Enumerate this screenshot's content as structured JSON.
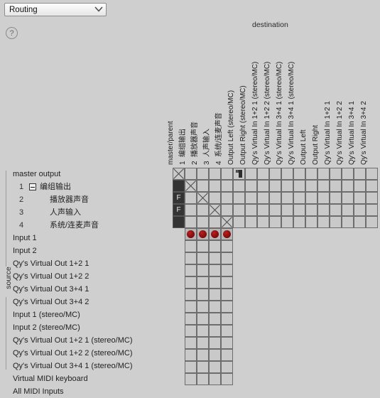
{
  "window": {
    "mode_select_value": "Routing",
    "help_icon": "question-mark-icon",
    "chevron_icon": "chevron-down-icon"
  },
  "axes": {
    "destination_label": "destination",
    "source_label": "source"
  },
  "columns": [
    {
      "num": "",
      "label": "master/parent"
    },
    {
      "num": "1",
      "label": "编组输出"
    },
    {
      "num": "2",
      "label": "播放器声音"
    },
    {
      "num": "3",
      "label": "人声输入"
    },
    {
      "num": "4",
      "label": "系统/连麦声音"
    },
    {
      "num": "",
      "label": "Output Left (stereo/MC)"
    },
    {
      "num": "",
      "label": "Output Right (stereo/MC)"
    },
    {
      "num": "",
      "label": "Qy's Virtual In 1+2 1 (stereo/MC)"
    },
    {
      "num": "",
      "label": "Qy's Virtual In 1+2 2 (stereo/MC)"
    },
    {
      "num": "",
      "label": "Qy's Virtual In 3+4 1 (stereo/MC)"
    },
    {
      "num": "",
      "label": "Qy's Virtual In 3+4 1 (stereo/MC)"
    },
    {
      "num": "",
      "label": "Output Left"
    },
    {
      "num": "",
      "label": "Output Right"
    },
    {
      "num": "",
      "label": "Qy's Virtual In 1+2 1"
    },
    {
      "num": "",
      "label": "Qy's Virtual In 1+2 2"
    },
    {
      "num": "",
      "label": "Qy's Virtual In 3+4 1"
    },
    {
      "num": "",
      "label": "Qy's Virtual In 3+4 2"
    }
  ],
  "rows": [
    {
      "num": "",
      "label": "master output",
      "indent": "lvl0",
      "expander": false
    },
    {
      "num": "1",
      "label": "编组输出",
      "indent": "lvl1",
      "expander": true
    },
    {
      "num": "2",
      "label": "播放器声音",
      "indent": "lvl1b",
      "expander": false
    },
    {
      "num": "3",
      "label": "人声输入",
      "indent": "lvl1b",
      "expander": false
    },
    {
      "num": "4",
      "label": "系统/连麦声音",
      "indent": "lvl1b",
      "expander": false
    },
    {
      "num": "",
      "label": "Input 1",
      "indent": "lvl0",
      "expander": false
    },
    {
      "num": "",
      "label": "Input 2",
      "indent": "lvl0",
      "expander": false
    },
    {
      "num": "",
      "label": "Qy's Virtual Out 1+2 1",
      "indent": "lvl0",
      "expander": false
    },
    {
      "num": "",
      "label": "Qy's Virtual Out 1+2 2",
      "indent": "lvl0",
      "expander": false
    },
    {
      "num": "",
      "label": "Qy's Virtual Out 3+4 1",
      "indent": "lvl0",
      "expander": false
    },
    {
      "num": "",
      "label": "Qy's Virtual Out 3+4 2",
      "indent": "lvl0",
      "expander": false
    },
    {
      "num": "",
      "label": "Input 1 (stereo/MC)",
      "indent": "lvl0",
      "expander": false
    },
    {
      "num": "",
      "label": "Input 2 (stereo/MC)",
      "indent": "lvl0",
      "expander": false
    },
    {
      "num": "",
      "label": "Qy's Virtual Out 1+2 1 (stereo/MC)",
      "indent": "lvl0",
      "expander": false
    },
    {
      "num": "",
      "label": "Qy's Virtual Out 1+2 2 (stereo/MC)",
      "indent": "lvl0",
      "expander": false
    },
    {
      "num": "",
      "label": "Qy's Virtual Out 3+4 1 (stereo/MC)",
      "indent": "lvl0",
      "expander": false
    },
    {
      "num": "",
      "label": "Virtual MIDI keyboard",
      "indent": "lvl0",
      "expander": false
    },
    {
      "num": "",
      "label": "All MIDI Inputs",
      "indent": "lvl0",
      "expander": false
    }
  ],
  "matrix": {
    "colors": {
      "grid_line": "#6d6d6d",
      "cell_bg": "#c9c9c9",
      "dark_cell": "#333333",
      "connection_red": "#9c1111",
      "background": "#cfcfcf"
    },
    "cells": [
      {
        "r": 0,
        "c": 0,
        "state": "x"
      },
      {
        "r": 1,
        "c": 0,
        "state": "dark",
        "text": ""
      },
      {
        "r": 2,
        "c": 0,
        "state": "dark",
        "text": "F"
      },
      {
        "r": 3,
        "c": 0,
        "state": "dark",
        "text": "F"
      },
      {
        "r": 4,
        "c": 0,
        "state": "dark",
        "text": ""
      },
      {
        "r": 1,
        "c": 1,
        "state": "x"
      },
      {
        "r": 2,
        "c": 2,
        "state": "x"
      },
      {
        "r": 3,
        "c": 3,
        "state": "x"
      },
      {
        "r": 4,
        "c": 4,
        "state": "x"
      },
      {
        "r": 0,
        "c": 5,
        "state": "speaker"
      },
      {
        "r": 5,
        "c": 1,
        "state": "red"
      },
      {
        "r": 5,
        "c": 2,
        "state": "red"
      },
      {
        "r": 5,
        "c": 3,
        "state": "red"
      },
      {
        "r": 5,
        "c": 4,
        "state": "red"
      }
    ],
    "full_width_rows": 5,
    "narrow_cols": [
      1,
      2,
      3,
      4
    ]
  }
}
